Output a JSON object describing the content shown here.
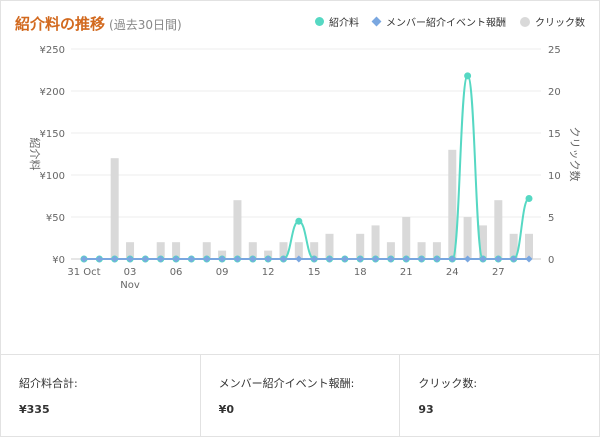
{
  "header": {
    "title": "紹介料の推移",
    "subtitle": "(過去30日間)"
  },
  "legend": [
    {
      "label": "紹介料",
      "color": "#56d8c3",
      "shape": "circle"
    },
    {
      "label": "メンバー紹介イベント報酬",
      "color": "#7aa7e0",
      "shape": "diamond"
    },
    {
      "label": "クリック数",
      "color": "#d9d9d9",
      "shape": "bar"
    }
  ],
  "stats": [
    {
      "label": "紹介料合計:",
      "value": "¥335"
    },
    {
      "label": "メンバー紹介イベント報酬:",
      "value": "¥0"
    },
    {
      "label": "クリック数:",
      "value": "93"
    }
  ],
  "chart_data": {
    "type": "bar+line",
    "x_tick_labels": [
      "31 Oct",
      "03",
      "06",
      "09",
      "12",
      "15",
      "18",
      "21",
      "24",
      "27"
    ],
    "x_tick_sublabels": {
      "03": "Nov"
    },
    "left_axis": {
      "label": "紹介料",
      "ticks": [
        "¥0",
        "¥50",
        "¥100",
        "¥150",
        "¥200",
        "¥250"
      ],
      "range": [
        0,
        250
      ]
    },
    "right_axis": {
      "label": "クリック数",
      "ticks": [
        "0",
        "5",
        "10",
        "15",
        "20",
        "25"
      ],
      "range": [
        0,
        25
      ]
    },
    "grid": true,
    "days": 30,
    "series": [
      {
        "name": "クリック数",
        "axis": "right",
        "kind": "bar",
        "color": "#d9d9d9",
        "values": [
          0,
          0,
          12,
          2,
          0,
          2,
          2,
          0,
          2,
          1,
          7,
          2,
          1,
          2,
          2,
          2,
          3,
          0,
          3,
          4,
          2,
          5,
          2,
          2,
          13,
          5,
          4,
          7,
          3,
          3
        ]
      },
      {
        "name": "紹介料",
        "axis": "left",
        "kind": "line",
        "color": "#56d8c3",
        "values": [
          0,
          0,
          0,
          0,
          0,
          0,
          0,
          0,
          0,
          0,
          0,
          0,
          0,
          0,
          45,
          0,
          0,
          0,
          0,
          0,
          0,
          0,
          0,
          0,
          0,
          218,
          0,
          0,
          0,
          72
        ]
      },
      {
        "name": "メンバー紹介イベント報酬",
        "axis": "left",
        "kind": "line",
        "color": "#7aa7e0",
        "values": [
          0,
          0,
          0,
          0,
          0,
          0,
          0,
          0,
          0,
          0,
          0,
          0,
          0,
          0,
          0,
          0,
          0,
          0,
          0,
          0,
          0,
          0,
          0,
          0,
          0,
          0,
          0,
          0,
          0,
          0
        ]
      }
    ]
  }
}
